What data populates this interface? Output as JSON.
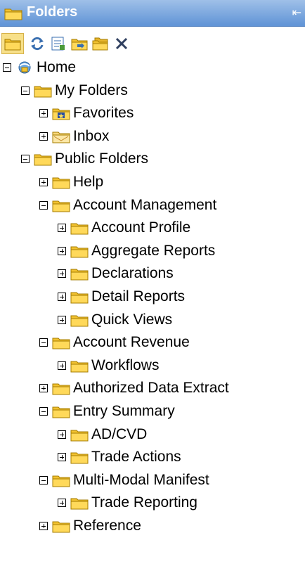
{
  "panel": {
    "title": "Folders",
    "collapse_glyph": "⇤"
  },
  "toolbar": {
    "buttons": [
      {
        "name": "folder-view-icon"
      },
      {
        "name": "refresh-icon"
      },
      {
        "name": "properties-icon"
      },
      {
        "name": "move-folder-icon"
      },
      {
        "name": "copy-folder-icon"
      },
      {
        "name": "delete-icon"
      }
    ]
  },
  "tree": [
    {
      "label": "Home",
      "level": 0,
      "state": "minus",
      "icon": "home-icon"
    },
    {
      "label": "My Folders",
      "level": 1,
      "state": "minus",
      "icon": "folder-icon"
    },
    {
      "label": "Favorites",
      "level": 2,
      "state": "plus",
      "icon": "favorites-folder-icon"
    },
    {
      "label": "Inbox",
      "level": 2,
      "state": "plus",
      "icon": "inbox-icon"
    },
    {
      "label": "Public Folders",
      "level": 1,
      "state": "minus",
      "icon": "folder-icon"
    },
    {
      "label": " Help",
      "level": 2,
      "state": "plus",
      "icon": "folder-icon"
    },
    {
      "label": "Account Management",
      "level": 2,
      "state": "minus",
      "icon": "folder-icon"
    },
    {
      "label": "Account Profile",
      "level": 3,
      "state": "plus",
      "icon": "folder-icon"
    },
    {
      "label": "Aggregate Reports",
      "level": 3,
      "state": "plus",
      "icon": "folder-icon"
    },
    {
      "label": "Declarations",
      "level": 3,
      "state": "plus",
      "icon": "folder-icon"
    },
    {
      "label": "Detail Reports",
      "level": 3,
      "state": "plus",
      "icon": "folder-icon"
    },
    {
      "label": "Quick Views",
      "level": 3,
      "state": "plus",
      "icon": "folder-icon"
    },
    {
      "label": "Account Revenue",
      "level": 2,
      "state": "minus",
      "icon": "folder-icon"
    },
    {
      "label": "Workflows",
      "level": 3,
      "state": "plus",
      "icon": "folder-icon"
    },
    {
      "label": "Authorized Data Extract",
      "level": 2,
      "state": "plus",
      "icon": "folder-icon"
    },
    {
      "label": "Entry Summary",
      "level": 2,
      "state": "minus",
      "icon": "folder-icon"
    },
    {
      "label": "AD/CVD",
      "level": 3,
      "state": "plus",
      "icon": "folder-icon"
    },
    {
      "label": "Trade Actions",
      "level": 3,
      "state": "plus",
      "icon": "folder-icon"
    },
    {
      "label": "Multi-Modal Manifest",
      "level": 2,
      "state": "minus",
      "icon": "folder-icon"
    },
    {
      "label": "Trade Reporting",
      "level": 3,
      "state": "plus",
      "icon": "folder-icon"
    },
    {
      "label": "Reference",
      "level": 2,
      "state": "plus",
      "icon": "folder-icon"
    }
  ]
}
